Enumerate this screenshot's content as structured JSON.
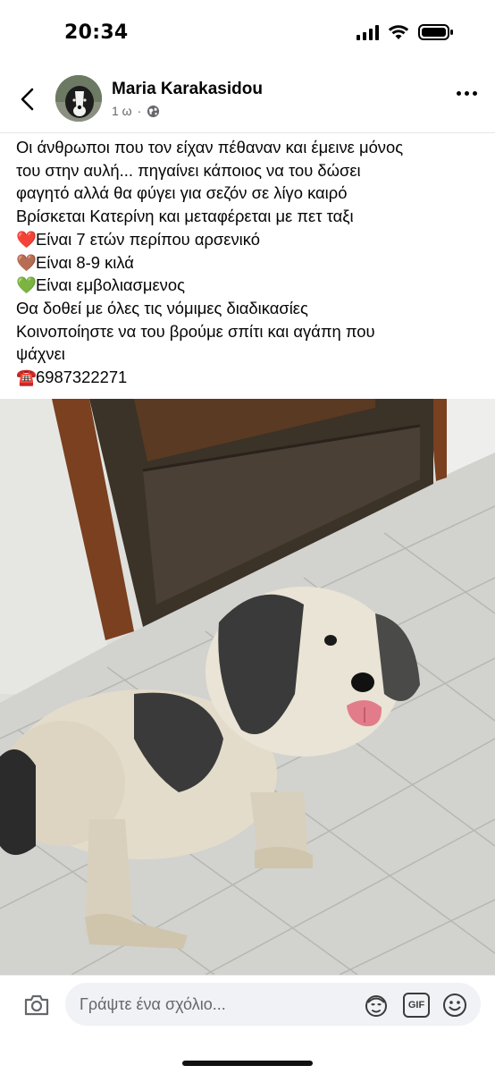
{
  "status_bar": {
    "time": "20:34"
  },
  "post": {
    "author": "Maria Karakasidou",
    "time_ago": "1 ω",
    "text_lines": [
      "Οι άνθρωποι που τον είχαν πέθαναν και έμεινε μόνος",
      "του στην αυλή... πηγαίνει κάποιος να του δώσει",
      "φαγητό αλλά θα φύγει για σεζόν σε λίγο καιρό",
      "Βρίσκεται Κατερίνη και μεταφέρεται με πετ ταξι",
      "Είναι 7 ετών περίπου αρσενικό",
      "Είναι 8-9 κιλά",
      "Είναι εμβολιασμενος",
      "Θα δοθεί με όλες τις νόμιμες διαδικασίες",
      "Κοινοποίηστε να του βρούμε σπίτι και αγάπη που",
      "ψάχνει",
      "6987322271"
    ],
    "emojis": {
      "red_heart": "❤️",
      "brown_heart": "🤎",
      "green_heart": "💚",
      "phone": "☎️"
    }
  },
  "comment_bar": {
    "placeholder": "Γράψτε ένα σχόλιο...",
    "gif_label": "GIF"
  }
}
